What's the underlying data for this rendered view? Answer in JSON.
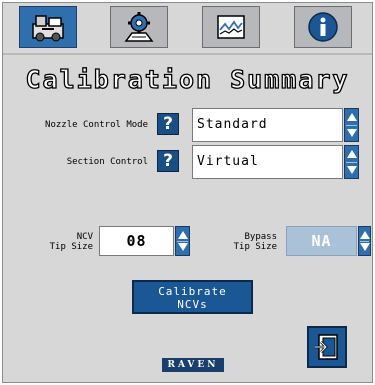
{
  "tabs": [
    {
      "icon": "machine-icon",
      "active": true
    },
    {
      "icon": "gear-settings-icon",
      "active": false
    },
    {
      "icon": "chart-icon",
      "active": false
    },
    {
      "icon": "info-icon",
      "active": false
    }
  ],
  "title": "Calibration Summary",
  "nozzle_control": {
    "label": "Nozzle Control Mode",
    "help": "?",
    "value": "Standard"
  },
  "section_control": {
    "label": "Section Control",
    "help": "?",
    "value": "Virtual"
  },
  "ncv_tip_size": {
    "label_line1": "NCV",
    "label_line2": "Tip Size",
    "value": "08"
  },
  "bypass_tip_size": {
    "label_line1": "Bypass",
    "label_line2": "Tip Size",
    "value": "NA"
  },
  "calibrate_button": {
    "line1": "Calibrate",
    "line2": "NCVs"
  },
  "logo": {
    "text": "RAVEN"
  },
  "exit_button": {
    "icon": "exit-icon"
  },
  "colors": {
    "accent": "#2f6fae",
    "panel": "#d7d7d7",
    "disabled_field": "#a9c2d8",
    "logo_bg": "#1a3f6d"
  }
}
